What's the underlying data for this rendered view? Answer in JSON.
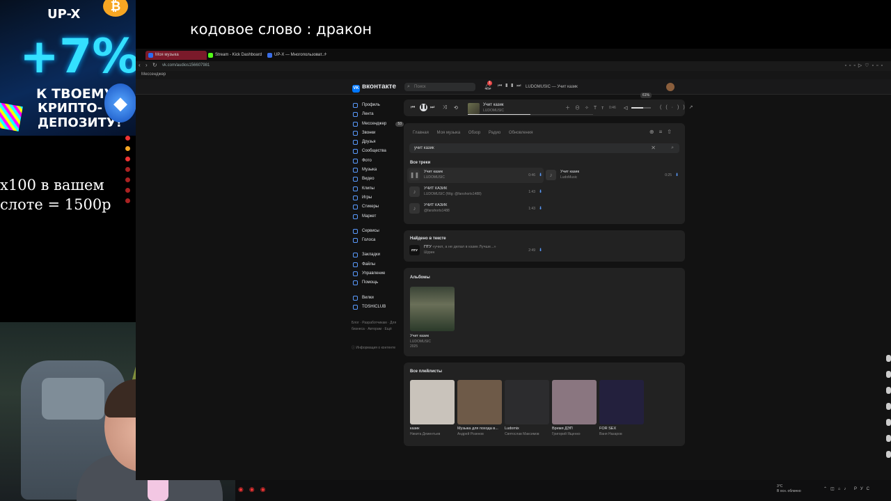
{
  "overlay": {
    "caption": "кодовое слово : дракон",
    "side_line1": "x100 в вашем",
    "side_line2": "слоте = 1500р",
    "promo": {
      "brand": "UP-X",
      "big": "+7%",
      "line1": "К ТВОЕМУ",
      "line2": "КРИПТО-ДЕПОЗИТУ!",
      "coin": "₿",
      "eth": "◆"
    }
  },
  "browser": {
    "tabs": [
      {
        "label": "Моя музыка",
        "color": "#2b6cf2",
        "active": true
      },
      {
        "label": "Stream - Kick Dashboard",
        "color": "#53fc18",
        "active": false
      },
      {
        "label": "UP-X — Многопользоват...",
        "color": "#3a6ee8",
        "active": false
      }
    ],
    "tab_plus": "+",
    "url": "vk.com/audios156607981",
    "bookmark": "Мессенджер"
  },
  "vk_header": {
    "logo": "вконтакте",
    "logo_mark": "VK",
    "search_placeholder": "Поиск",
    "notif_count": "1",
    "now_playing": "LUDOMUSIC — Учит казик"
  },
  "nav": {
    "items": [
      {
        "label": "Профиль"
      },
      {
        "label": "Лента"
      },
      {
        "label": "Мессенджер",
        "badge": "53"
      },
      {
        "label": "Звонки"
      },
      {
        "label": "Друзья"
      },
      {
        "label": "Сообщества"
      },
      {
        "label": "Фото"
      },
      {
        "label": "Музыка"
      },
      {
        "label": "Видео"
      },
      {
        "label": "Клипы"
      },
      {
        "label": "Игры"
      },
      {
        "label": "Стикеры"
      },
      {
        "label": "Маркет"
      }
    ],
    "items2": [
      {
        "label": "Сервисы"
      },
      {
        "label": "Голоса"
      }
    ],
    "items3": [
      {
        "label": "Закладки"
      },
      {
        "label": "Файлы"
      },
      {
        "label": "Управление"
      },
      {
        "label": "Помощь"
      }
    ],
    "items4": [
      {
        "label": "Вилки"
      },
      {
        "label": "TOSHICLUB"
      }
    ],
    "footer": "Блог · Разработчикам · Для бизнеса · Авторам · Ещё",
    "info": "Информация о контенте"
  },
  "player": {
    "title": "Учит казик",
    "artist": "LUDOMUSIC",
    "time": "0:46",
    "volume_label": "61%",
    "volume": 0.61,
    "progress": 0.5
  },
  "music": {
    "tabs": [
      "Главная",
      "Моя музыка",
      "Обзор",
      "Радио",
      "Обновления"
    ],
    "query": "учит казик",
    "all_tracks_title": "Все треки",
    "tracks": [
      {
        "title": "Учит казик",
        "artist": "LUDOMUSIC",
        "duration": "0:46",
        "icon": "❚❚"
      },
      {
        "title": "УЧИТ КАЗИК",
        "artist": "LUDOMUSIC (ft/tg: @fanshorts1488)",
        "duration": "1:43",
        "icon": "♪"
      },
      {
        "title": "УЧИТ КАЗИК",
        "artist": "@fanshorts1488",
        "duration": "1:43",
        "icon": "♪"
      },
      {
        "title": "Учит казик",
        "artist": "LudoMusic",
        "duration": "0:25",
        "icon": "♪"
      }
    ],
    "lyrics_title": "Найдено в тексте",
    "lyrics_track": {
      "title": "ПТУ",
      "snippet": "«учил, а не делал в казик Лучше...»",
      "artist": "Шурин",
      "duration": "2:49",
      "cover": "ПТУ"
    },
    "albums_title": "Альбомы",
    "album": {
      "title": "Учит казик",
      "artist": "LUDOMUSIC",
      "year": "2025"
    },
    "playlists_title": "Все плейлисты",
    "playlists": [
      {
        "title": "казик",
        "author": "Никита Дементьев",
        "color": "#c9c3bb"
      },
      {
        "title": "Музыка для похода в...",
        "author": "Андрей Розенов",
        "color": "#6e5a48"
      },
      {
        "title": "Ludomix",
        "author": "Святослав Максимов",
        "color": "#2c2c2e"
      },
      {
        "title": "Время ДЭП",
        "author": "Григорий Ященко",
        "color": "#8a7680"
      },
      {
        "title": "FOR SEX",
        "author": "Ваня Назаров",
        "color": "#23203d"
      }
    ]
  },
  "taskbar": {
    "temp": "3°C",
    "weather": "В осн. облачно",
    "lang": "РУС"
  }
}
